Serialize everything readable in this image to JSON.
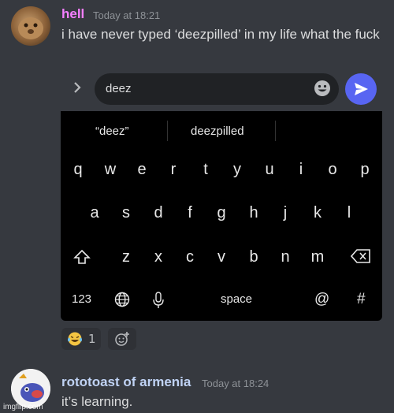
{
  "messages": [
    {
      "username": "hell",
      "timestamp": "Today at 18:21",
      "text": "i have never typed ‘deezpilled’ in my life what the fuck",
      "name_color": "#f47fff"
    },
    {
      "username": "rototoast of armenia",
      "timestamp": "Today at 18:24",
      "text": "it’s learning."
    }
  ],
  "input": {
    "value": "deez"
  },
  "keyboard": {
    "suggestions": [
      "“deez”",
      "deezpilled"
    ],
    "row1": [
      "q",
      "w",
      "e",
      "r",
      "t",
      "y",
      "u",
      "i",
      "o",
      "p"
    ],
    "row2": [
      "a",
      "s",
      "d",
      "f",
      "g",
      "h",
      "j",
      "k",
      "l"
    ],
    "row3": [
      "z",
      "x",
      "c",
      "v",
      "b",
      "n",
      "m"
    ],
    "bottom": {
      "numbers": "123",
      "space": "space",
      "at": "@",
      "hash": "#"
    }
  },
  "reaction": {
    "emoji": "laughing-emoji",
    "count": "1"
  },
  "watermark": "imgflip.com",
  "colors": {
    "background": "#36393f",
    "send_button": "#5865f2",
    "keyboard": "#000000"
  }
}
